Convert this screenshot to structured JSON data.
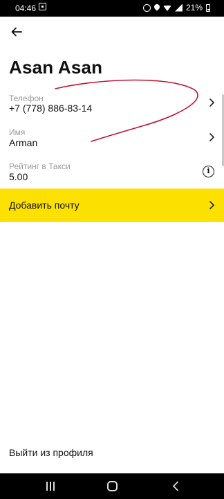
{
  "status_bar": {
    "time": "04:46",
    "battery": "21%",
    "icons": [
      "media-icon",
      "alarm-icon",
      "location-icon",
      "wifi-icon",
      "signal-icon",
      "battery-icon"
    ]
  },
  "header": {
    "back_icon": "arrow-left-icon"
  },
  "profile": {
    "name": "Asan Asan",
    "phone": {
      "label": "Телефон",
      "value": "+7 (778) 886-83-14"
    },
    "first_name": {
      "label": "Имя",
      "value": "Arman"
    },
    "rating": {
      "label": "Рейтинг в Такси",
      "value": "5.00",
      "info_icon": "info-icon"
    }
  },
  "add_email": {
    "label": "Добавить почту",
    "color": "#fce000"
  },
  "logout": {
    "label": "Выйти из профиля"
  },
  "annotation": {
    "color": "#c8102e"
  },
  "nav_bar": {
    "icons": [
      "recents-icon",
      "home-icon",
      "back-icon"
    ]
  }
}
